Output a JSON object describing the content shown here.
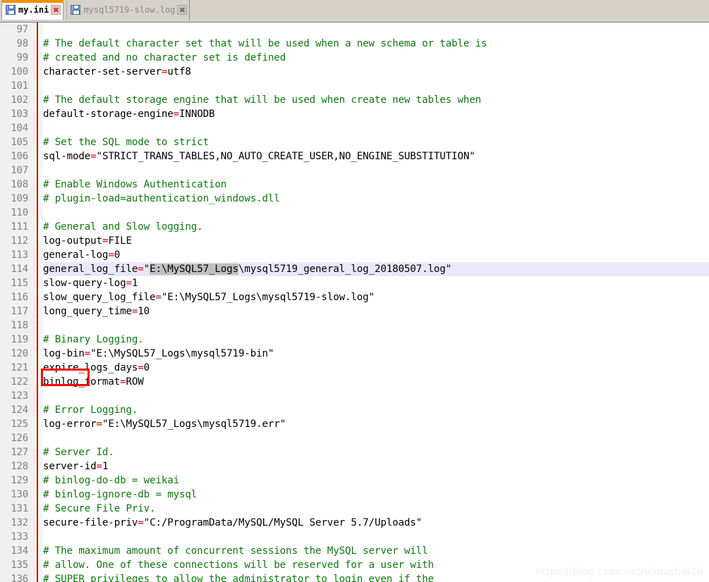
{
  "window": {
    "background_color": "#d6d2ca",
    "editor_background": "#ffffff"
  },
  "tabs": [
    {
      "label": "my.ini",
      "active": true,
      "icon": "floppy-disk-icon",
      "close_label": "✖",
      "accent_color": "#f29000"
    },
    {
      "label": "mysql5719-slow.log",
      "active": false,
      "icon": "floppy-disk-icon",
      "close_label": "✖",
      "accent_color": "#8b8b8b"
    }
  ],
  "editor": {
    "language": "ini",
    "first_visible_line": 97,
    "last_visible_line": 136,
    "current_line": 114,
    "selection_text": "E:\\MySQL57_Logs",
    "comment_color": "#117711",
    "operator_color": "#cc0000",
    "current_line_color": "#e8e8fa",
    "selection_color": "#c0c0c0",
    "gutter_color": "#f0f0f0",
    "line_number_color": "#808080",
    "right_margin_color": "#d40000",
    "lines": [
      {
        "n": 97,
        "segments": []
      },
      {
        "n": 98,
        "segments": [
          {
            "t": "# The default character set that will be used when a new schema or table is",
            "c": "cm"
          }
        ]
      },
      {
        "n": 99,
        "segments": [
          {
            "t": "# created and no character set is defined",
            "c": "cm"
          }
        ]
      },
      {
        "n": 100,
        "segments": [
          {
            "t": "character-set-server",
            "c": ""
          },
          {
            "t": "=",
            "c": "op"
          },
          {
            "t": "utf8",
            "c": ""
          }
        ]
      },
      {
        "n": 101,
        "segments": []
      },
      {
        "n": 102,
        "segments": [
          {
            "t": "# The default storage engine that will be used when create new tables when",
            "c": "cm"
          }
        ]
      },
      {
        "n": 103,
        "segments": [
          {
            "t": "default-storage-engine",
            "c": ""
          },
          {
            "t": "=",
            "c": "op"
          },
          {
            "t": "INNODB",
            "c": ""
          }
        ]
      },
      {
        "n": 104,
        "segments": []
      },
      {
        "n": 105,
        "segments": [
          {
            "t": "# Set the SQL mode to strict",
            "c": "cm"
          }
        ]
      },
      {
        "n": 106,
        "segments": [
          {
            "t": "sql-mode",
            "c": ""
          },
          {
            "t": "=",
            "c": "op"
          },
          {
            "t": "\"STRICT_TRANS_TABLES,NO_AUTO_CREATE_USER,NO_ENGINE_SUBSTITUTION\"",
            "c": ""
          }
        ]
      },
      {
        "n": 107,
        "segments": []
      },
      {
        "n": 108,
        "segments": [
          {
            "t": "# Enable Windows Authentication",
            "c": "cm"
          }
        ]
      },
      {
        "n": 109,
        "segments": [
          {
            "t": "# plugin-load=authentication_windows.dll",
            "c": "cm"
          }
        ]
      },
      {
        "n": 110,
        "segments": []
      },
      {
        "n": 111,
        "segments": [
          {
            "t": "# General and Slow logging.",
            "c": "cm"
          }
        ]
      },
      {
        "n": 112,
        "segments": [
          {
            "t": "log-output",
            "c": ""
          },
          {
            "t": "=",
            "c": "op"
          },
          {
            "t": "FILE",
            "c": ""
          }
        ]
      },
      {
        "n": 113,
        "segments": [
          {
            "t": "general-log",
            "c": ""
          },
          {
            "t": "=",
            "c": "op"
          },
          {
            "t": "0",
            "c": ""
          }
        ]
      },
      {
        "n": 114,
        "current": true,
        "segments": [
          {
            "t": "general_log_file",
            "c": ""
          },
          {
            "t": "=",
            "c": "op"
          },
          {
            "t": "\"",
            "c": ""
          },
          {
            "t": "E:\\MySQL57_Logs",
            "c": "sel"
          },
          {
            "t": "\\mysql5719_general_log_20180507.log\"",
            "c": ""
          }
        ]
      },
      {
        "n": 115,
        "segments": [
          {
            "t": "slow-query-log",
            "c": ""
          },
          {
            "t": "=",
            "c": "op"
          },
          {
            "t": "1",
            "c": ""
          }
        ]
      },
      {
        "n": 116,
        "segments": [
          {
            "t": "slow_query_log_file",
            "c": ""
          },
          {
            "t": "=",
            "c": "op"
          },
          {
            "t": "\"E:\\MySQL57_Logs\\mysql5719-slow.log\"",
            "c": ""
          }
        ]
      },
      {
        "n": 117,
        "segments": [
          {
            "t": "long_query_time",
            "c": ""
          },
          {
            "t": "=",
            "c": "op"
          },
          {
            "t": "10",
            "c": ""
          }
        ]
      },
      {
        "n": 118,
        "segments": []
      },
      {
        "n": 119,
        "segments": [
          {
            "t": "# Binary Logging.",
            "c": "cm"
          }
        ]
      },
      {
        "n": 120,
        "segments": [
          {
            "t": "log-bin",
            "c": ""
          },
          {
            "t": "=",
            "c": "op"
          },
          {
            "t": "\"E:\\MySQL57_Logs\\mysql5719-bin\"",
            "c": ""
          }
        ]
      },
      {
        "n": 121,
        "segments": [
          {
            "t": "expire_logs_days",
            "c": ""
          },
          {
            "t": "=",
            "c": "op"
          },
          {
            "t": "0",
            "c": ""
          }
        ]
      },
      {
        "n": 122,
        "segments": [
          {
            "t": "binlog_format",
            "c": ""
          },
          {
            "t": "=",
            "c": "op"
          },
          {
            "t": "ROW",
            "c": ""
          }
        ]
      },
      {
        "n": 123,
        "segments": []
      },
      {
        "n": 124,
        "segments": [
          {
            "t": "# Error Logging.",
            "c": "cm"
          }
        ]
      },
      {
        "n": 125,
        "segments": [
          {
            "t": "log-error",
            "c": ""
          },
          {
            "t": "=",
            "c": "op"
          },
          {
            "t": "\"E:\\MySQL57_Logs\\mysql5719.err\"",
            "c": ""
          }
        ]
      },
      {
        "n": 126,
        "segments": []
      },
      {
        "n": 127,
        "segments": [
          {
            "t": "# Server Id.",
            "c": "cm"
          }
        ]
      },
      {
        "n": 128,
        "segments": [
          {
            "t": "server-id",
            "c": ""
          },
          {
            "t": "=",
            "c": "op"
          },
          {
            "t": "1",
            "c": ""
          }
        ]
      },
      {
        "n": 129,
        "segments": [
          {
            "t": "# binlog-do-db = weikai",
            "c": "cm"
          }
        ]
      },
      {
        "n": 130,
        "segments": [
          {
            "t": "# binlog-ignore-db = mysql",
            "c": "cm"
          }
        ]
      },
      {
        "n": 131,
        "segments": [
          {
            "t": "# Secure File Priv.",
            "c": "cm"
          }
        ]
      },
      {
        "n": 132,
        "segments": [
          {
            "t": "secure-file-priv",
            "c": ""
          },
          {
            "t": "=",
            "c": "op"
          },
          {
            "t": "\"C:/ProgramData/MySQL/MySQL Server 5.7/Uploads\"",
            "c": ""
          }
        ]
      },
      {
        "n": 133,
        "segments": []
      },
      {
        "n": 134,
        "segments": [
          {
            "t": "# The maximum amount of concurrent sessions the MySQL server will",
            "c": "cm"
          }
        ]
      },
      {
        "n": 135,
        "segments": [
          {
            "t": "# allow. One of these connections will be reserved for a user with",
            "c": "cm"
          }
        ]
      },
      {
        "n": 136,
        "segments": [
          {
            "t": "# SUPER privileges to allow the administrator to login even if the",
            "c": "cm"
          }
        ]
      }
    ]
  },
  "annotation": {
    "type": "rectangle",
    "color": "#ff0000",
    "target_text": "log-bin",
    "target_line": 120
  },
  "watermark": {
    "text": "https://blog.csdn.net/aimashi620"
  }
}
